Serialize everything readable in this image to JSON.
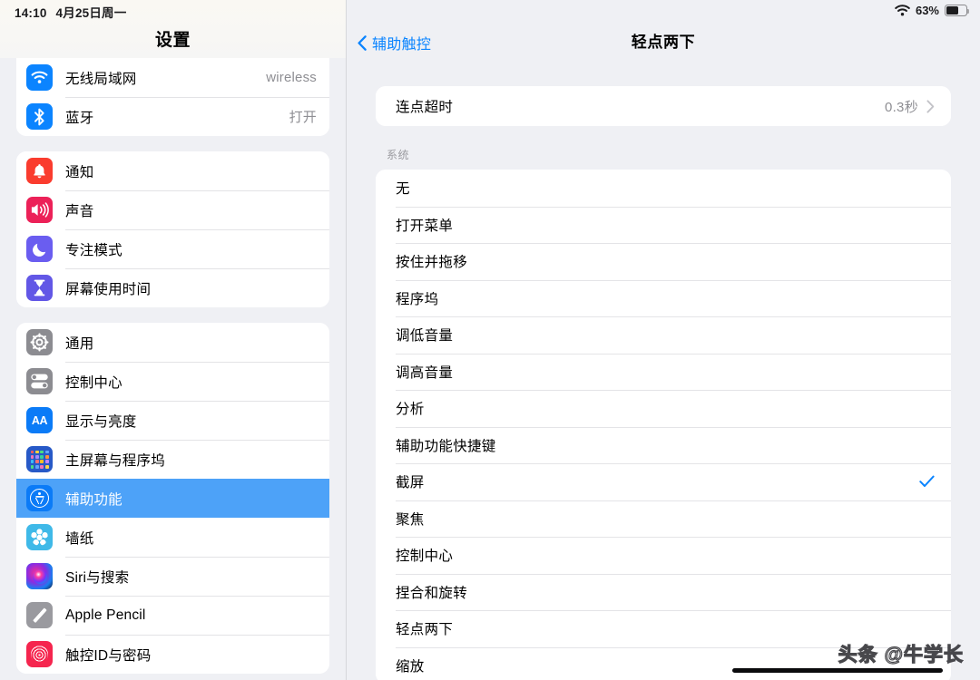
{
  "statusbar": {
    "time": "14:10",
    "date": "4月25日周一",
    "battery_percent": "63%",
    "wifi_icon": "wifi-icon",
    "battery_icon": "battery-icon",
    "battery_level": 63
  },
  "sidebar": {
    "title": "设置",
    "groups": [
      {
        "clipped": true,
        "items": [
          {
            "label": "无线局域网",
            "value": "wireless",
            "icon": "wifi-icon",
            "icon_class": "ic-wifi",
            "selected": false
          },
          {
            "label": "蓝牙",
            "value": "打开",
            "icon": "bluetooth-icon",
            "icon_class": "ic-bt",
            "selected": false
          }
        ]
      },
      {
        "clipped": false,
        "items": [
          {
            "label": "通知",
            "value": "",
            "icon": "bell-icon",
            "icon_class": "ic-notif",
            "selected": false
          },
          {
            "label": "声音",
            "value": "",
            "icon": "speaker-icon",
            "icon_class": "ic-sound",
            "selected": false
          },
          {
            "label": "专注模式",
            "value": "",
            "icon": "moon-icon",
            "icon_class": "ic-focus",
            "selected": false
          },
          {
            "label": "屏幕使用时间",
            "value": "",
            "icon": "hourglass-icon",
            "icon_class": "ic-screen",
            "selected": false
          }
        ]
      },
      {
        "clipped": false,
        "items": [
          {
            "label": "通用",
            "value": "",
            "icon": "gear-icon",
            "icon_class": "ic-gen",
            "selected": false
          },
          {
            "label": "控制中心",
            "value": "",
            "icon": "toggles-icon",
            "icon_class": "ic-cc",
            "selected": false
          },
          {
            "label": "显示与亮度",
            "value": "",
            "icon": "text-size-icon",
            "icon_class": "ic-disp",
            "selected": false
          },
          {
            "label": "主屏幕与程序坞",
            "value": "",
            "icon": "app-grid-icon",
            "icon_class": "ic-home",
            "selected": false
          },
          {
            "label": "辅助功能",
            "value": "",
            "icon": "accessibility-icon",
            "icon_class": "ic-acc",
            "selected": true
          },
          {
            "label": "墙纸",
            "value": "",
            "icon": "flower-icon",
            "icon_class": "ic-wall",
            "selected": false
          },
          {
            "label": "Siri与搜索",
            "value": "",
            "icon": "siri-orb-icon",
            "icon_class": "ic-siri",
            "selected": false
          },
          {
            "label": "Apple Pencil",
            "value": "",
            "icon": "pencil-icon",
            "icon_class": "ic-pencil",
            "selected": false
          },
          {
            "label": "触控ID与密码",
            "value": "",
            "icon": "fingerprint-icon",
            "icon_class": "ic-touch",
            "selected": false
          }
        ]
      }
    ]
  },
  "detail": {
    "back_label": "辅助触控",
    "back_icon": "chevron-left-icon",
    "title": "轻点两下",
    "timeout_row": {
      "label": "连点超时",
      "value": "0.3秒",
      "disclosure_icon": "chevron-right-icon"
    },
    "section_header": "系统",
    "check_icon": "checkmark-icon",
    "options": [
      {
        "label": "无",
        "checked": false
      },
      {
        "label": "打开菜单",
        "checked": false
      },
      {
        "label": "按住并拖移",
        "checked": false
      },
      {
        "label": "程序坞",
        "checked": false
      },
      {
        "label": "调低音量",
        "checked": false
      },
      {
        "label": "调高音量",
        "checked": false
      },
      {
        "label": "分析",
        "checked": false
      },
      {
        "label": "辅助功能快捷键",
        "checked": false
      },
      {
        "label": "截屏",
        "checked": true
      },
      {
        "label": "聚焦",
        "checked": false
      },
      {
        "label": "控制中心",
        "checked": false
      },
      {
        "label": "捏合和旋转",
        "checked": false
      },
      {
        "label": "轻点两下",
        "checked": false
      },
      {
        "label": "缩放",
        "checked": false
      }
    ]
  },
  "watermark": {
    "text": "头条 @牛学长"
  },
  "colors": {
    "accent_blue": "#0a84ff",
    "selection_blue": "#4da2f8",
    "page_bg": "#eff0f4",
    "card_bg": "#ffffff",
    "secondary_text": "#8e8e93"
  }
}
